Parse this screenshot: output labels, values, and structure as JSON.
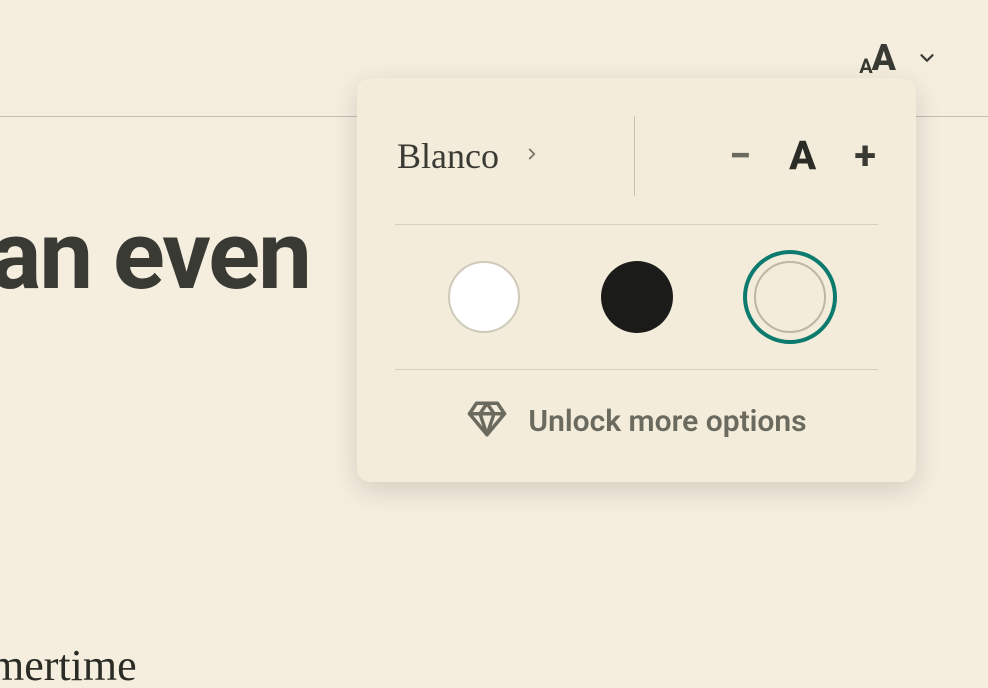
{
  "topbar": {
    "font_trigger_small": "A",
    "font_trigger_big": "A"
  },
  "background": {
    "heading_partial": "an even",
    "subtext_partial": "mertime"
  },
  "popover": {
    "font_name": "Blanco",
    "size_minus": "−",
    "size_indicator": "A",
    "size_plus": "+",
    "themes": {
      "light": "#ffffff",
      "dark": "#1b1b19",
      "sepia": "#f3ecdb",
      "selected": "sepia",
      "accent": "#0d7a6e"
    },
    "unlock_label": "Unlock more options"
  }
}
